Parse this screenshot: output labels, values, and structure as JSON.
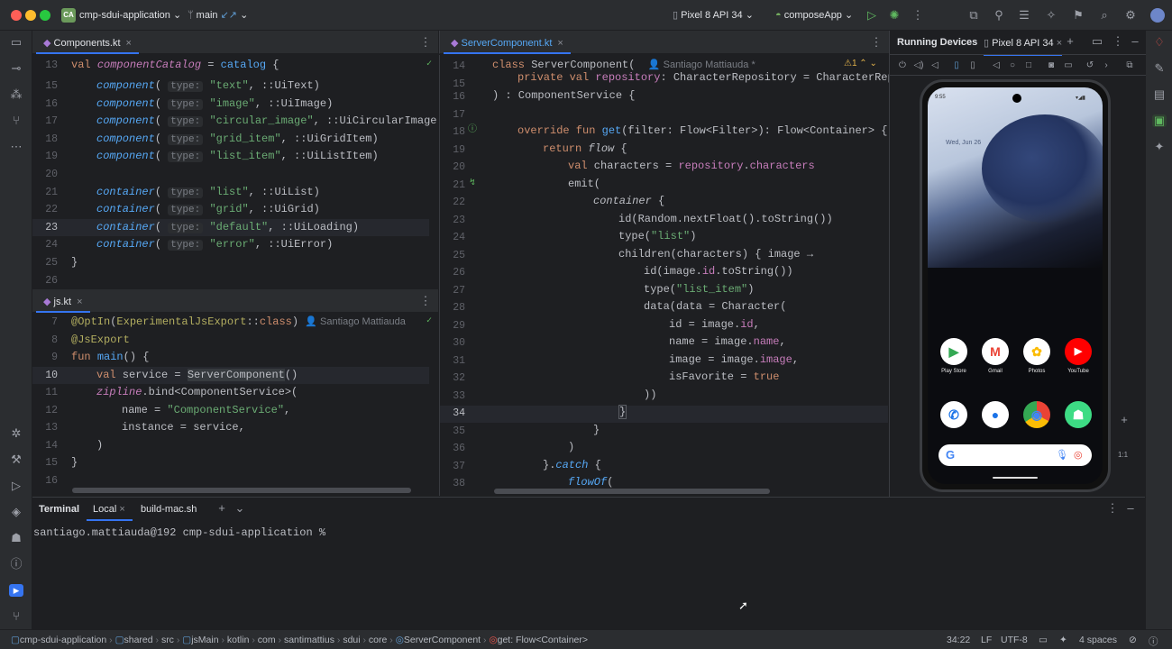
{
  "titlebar": {
    "project_badge": "CA",
    "project": "cmp-sdui-application",
    "branch": "main",
    "device": "Pixel 8 API 34",
    "run_config": "composeApp"
  },
  "editor_left": {
    "tab1": "Components.kt",
    "tab2": "js.kt"
  },
  "editor_center": {
    "tab": "ServerComponent.kt",
    "author": "Santiago Mattiauda *",
    "warn_count": "1"
  },
  "js_author": "Santiago Mattiauda",
  "devices": {
    "tab_running": "Running Devices",
    "tab_device": "Pixel 8 API 34",
    "phone_time": "9:55",
    "date_widget": "Wed, Jun 26",
    "apps": [
      {
        "label": "Play Store"
      },
      {
        "label": "Gmail"
      },
      {
        "label": "Photos"
      },
      {
        "label": "YouTube"
      }
    ],
    "zoom": "1:1"
  },
  "terminal": {
    "tab_label": "Terminal",
    "tab_local": "Local",
    "tab_build": "build-mac.sh",
    "prompt": "santiago.mattiauda@192 cmp-sdui-application %"
  },
  "statusbar": {
    "crumbs": [
      "cmp-sdui-application",
      "shared",
      "src",
      "jsMain",
      "kotlin",
      "com",
      "santimattius",
      "sdui",
      "core",
      "ServerComponent",
      "get: Flow<Container>"
    ],
    "position": "34:22",
    "line_sep": "LF",
    "encoding": "UTF-8",
    "indent": "4 spaces"
  }
}
